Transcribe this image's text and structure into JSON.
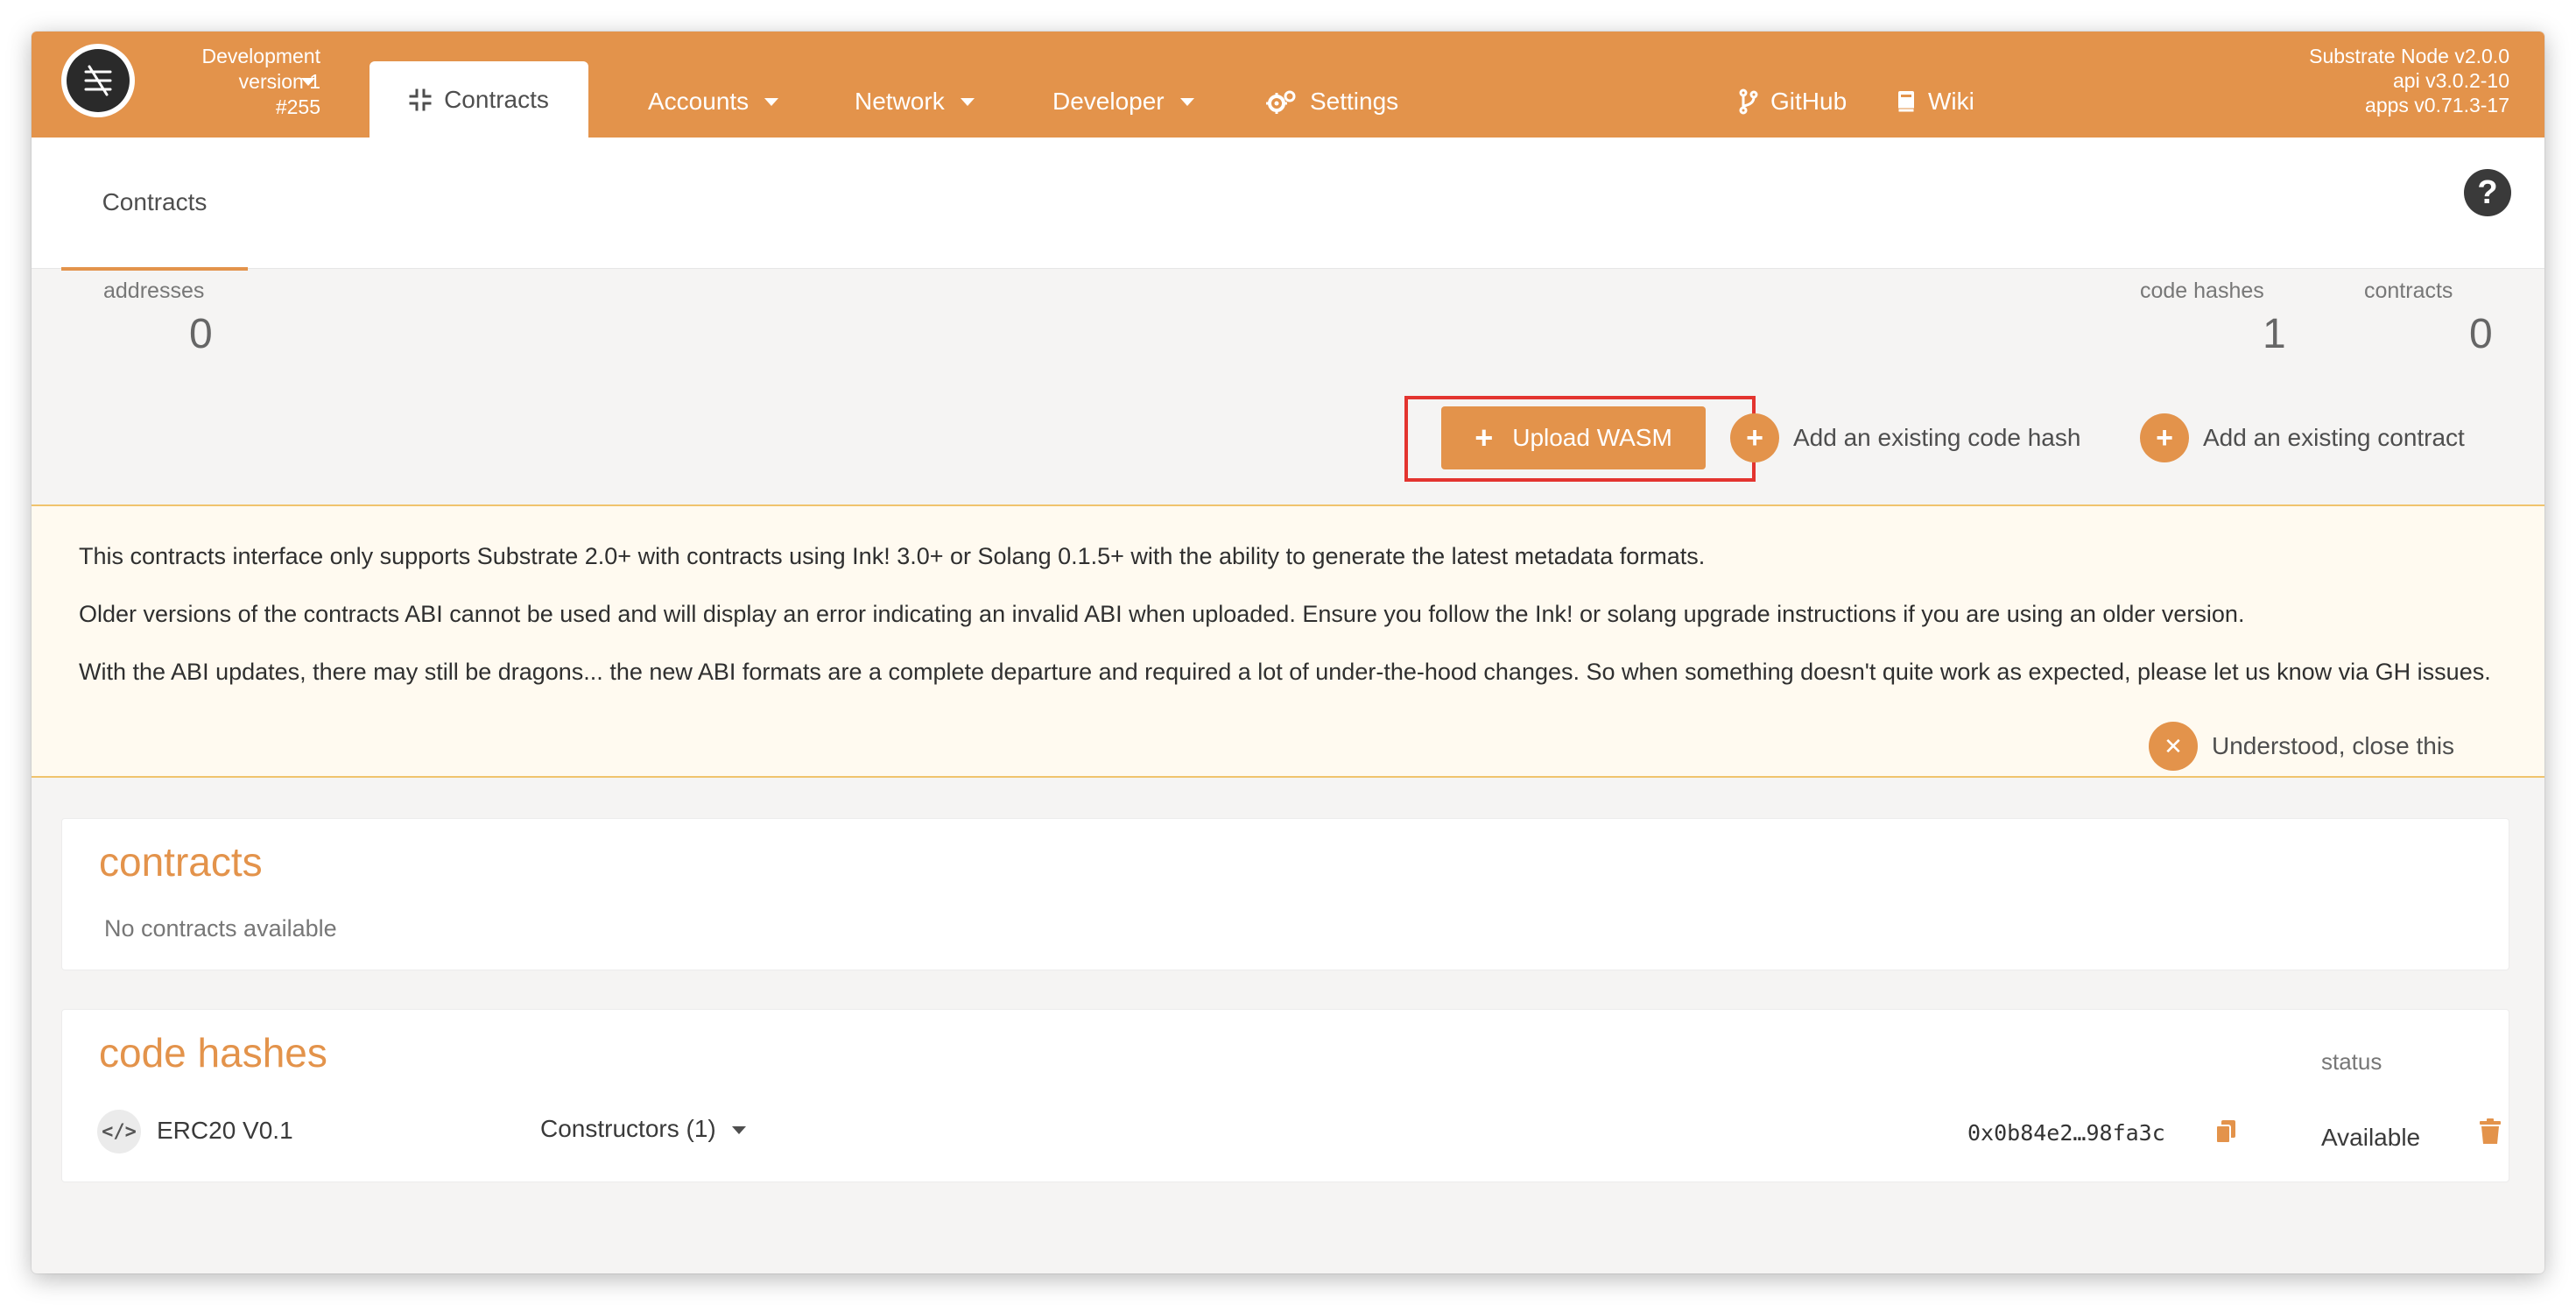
{
  "topbar": {
    "chain": {
      "name": "Development",
      "version": "version 1",
      "block": "#255"
    },
    "active_tab": "Contracts",
    "nav": [
      {
        "label": "Accounts",
        "has_dropdown": true
      },
      {
        "label": "Network",
        "has_dropdown": true
      },
      {
        "label": "Developer",
        "has_dropdown": true
      },
      {
        "label": "Settings",
        "icon": "gears-icon"
      },
      {
        "label": "GitHub",
        "icon": "code-branch-icon"
      },
      {
        "label": "Wiki",
        "icon": "book-icon"
      }
    ],
    "versions": [
      "Substrate Node v2.0.0",
      "api v3.0.2-10",
      "apps v0.71.3-17"
    ]
  },
  "subheader": {
    "tab": "Contracts",
    "help_symbol": "?"
  },
  "summary": {
    "addresses": {
      "label": "addresses",
      "value": "0"
    },
    "code_hashes": {
      "label": "code hashes",
      "value": "1"
    },
    "contracts": {
      "label": "contracts",
      "value": "0"
    }
  },
  "actions": {
    "upload": "Upload WASM",
    "add_code_hash": "Add an existing code hash",
    "add_contract": "Add an existing contract",
    "plus_symbol": "+"
  },
  "notice": {
    "paragraphs": [
      "This contracts interface only supports Substrate 2.0+ with contracts using Ink! 3.0+ or Solang 0.1.5+ with the ability to generate the latest metadata formats.",
      "Older versions of the contracts ABI cannot be used and will display an error indicating an invalid ABI when uploaded. Ensure you follow the Ink! or solang upgrade instructions if you are using an older version.",
      "With the ABI updates, there may still be dragons... the new ABI formats are a complete departure and required a lot of under-the-hood changes. So when something doesn't quite work as expected, please let us know via GH issues."
    ],
    "close_label": "Understood, close this",
    "close_symbol": "✕"
  },
  "contracts_card": {
    "title": "contracts",
    "empty": "No contracts available"
  },
  "code_hashes_card": {
    "title": "code hashes",
    "status_header": "status",
    "rows": [
      {
        "icon_text": "</>",
        "name": "ERC20 V0.1",
        "constructors": "Constructors (1)",
        "hash": "0x0b84e2…98fa3c",
        "status": "Available"
      }
    ]
  },
  "colors": {
    "accent": "#e3934b",
    "highlight": "#e3342f",
    "notice_bg": "#fffaf0"
  }
}
